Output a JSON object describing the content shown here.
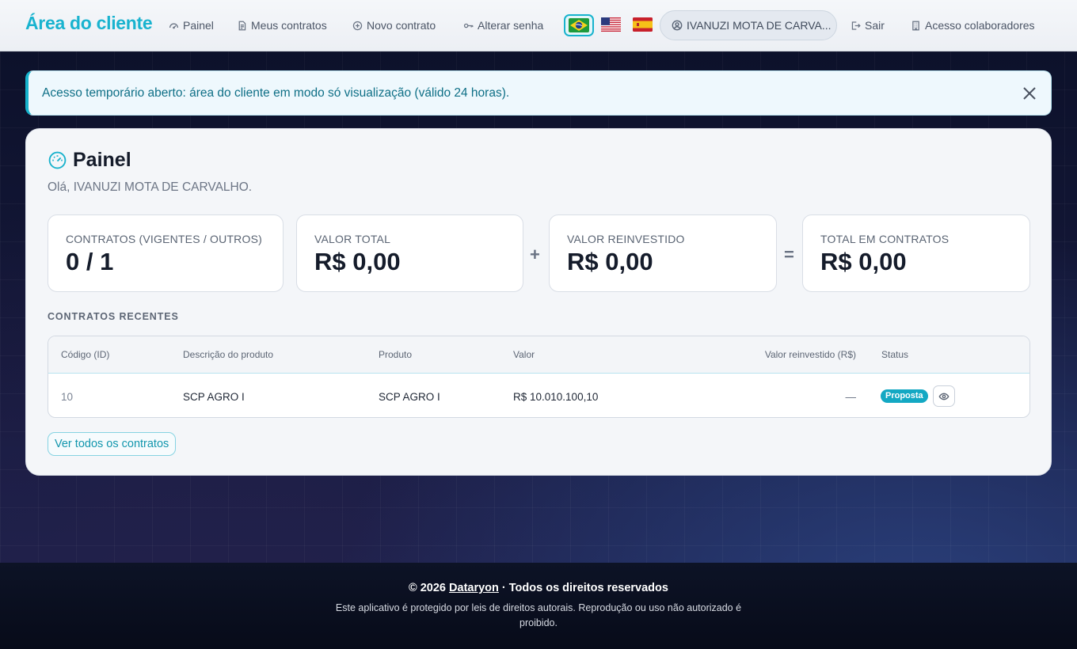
{
  "navbar": {
    "brand": "Área do cliente",
    "links": {
      "painel": "Painel",
      "meus_contratos": "Meus contratos",
      "novo_contrato": "Novo contrato",
      "alterar_senha": "Alterar senha",
      "sair": "Sair",
      "acesso_colaboradores": "Acesso colaboradores"
    },
    "languages": [
      "pt-BR",
      "en-US",
      "es-ES"
    ],
    "selected_language": "pt-BR",
    "user_name": "IVANUZI MOTA DE CARVA..."
  },
  "alert": {
    "message": "Acesso temporário aberto: área do cliente em modo só visualização (válido 24 horas)."
  },
  "panel": {
    "title": "Painel",
    "greeting": "Olá, IVANUZI MOTA DE CARVALHO.",
    "stats": [
      {
        "label": "Contratos (vigentes / outros)",
        "value": "0 / 1"
      },
      {
        "label": "Valor total",
        "value": "R$ 0,00"
      },
      {
        "label": "Valor reinvestido",
        "value": "R$ 0,00"
      },
      {
        "label": "Total em contratos",
        "value": "R$ 0,00"
      }
    ],
    "operators": {
      "plus": "+",
      "equals": "="
    },
    "recent_label": "CONTRATOS RECENTES",
    "table": {
      "columns": [
        "Código (ID)",
        "Descrição do produto",
        "Produto",
        "Valor",
        "Valor reinvestido (R$)",
        "Status"
      ],
      "rows": [
        {
          "id": "10",
          "descricao": "SCP AGRO I",
          "produto": "SCP AGRO I",
          "valor": "R$ 10.010.100,10",
          "reinvestido": "—",
          "status": "Proposta"
        }
      ]
    },
    "view_all": "Ver todos os contratos"
  },
  "footer": {
    "copyright_prefix": "© 2026",
    "company": "Dataryon",
    "rights": "· Todos os direitos reservados",
    "notice": "Este aplicativo é protegido por leis de direitos autorais. Reprodução ou uso não autorizado é proibido."
  },
  "colors": {
    "accent": "#19b3cf",
    "badge": "#13a8c3",
    "background_dark": "#0b1028"
  }
}
